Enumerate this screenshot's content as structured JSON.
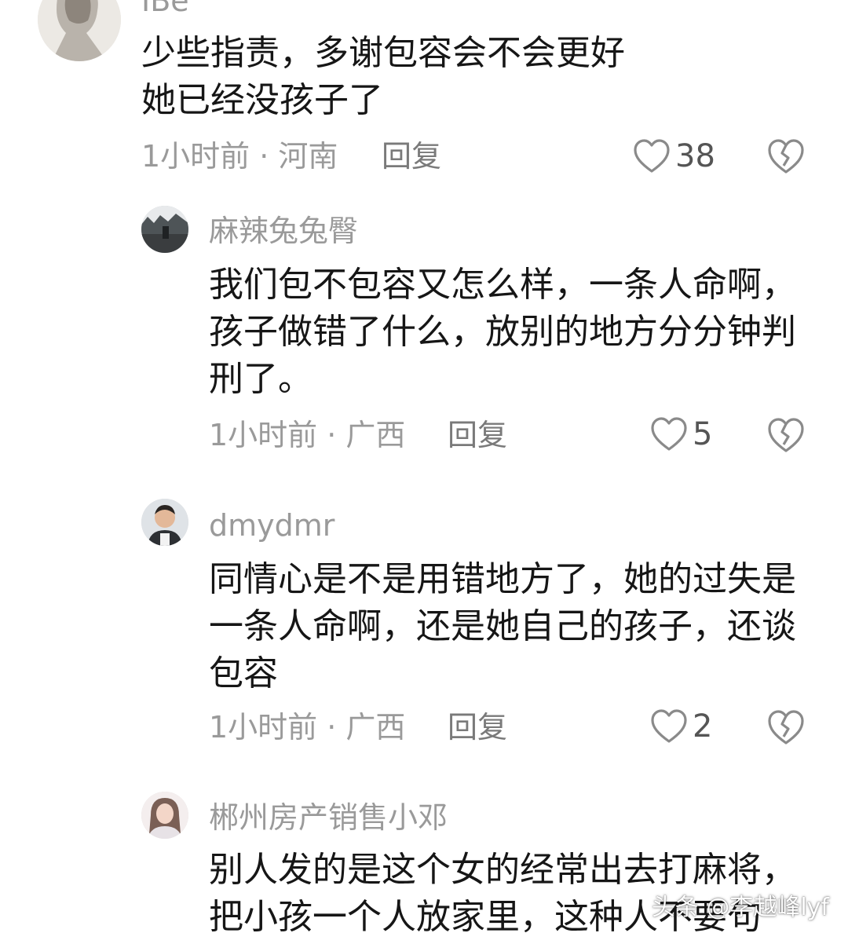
{
  "comments": [
    {
      "username": "IBe",
      "lines": [
        "少些指责，多谢包容会不会更好",
        "她已经没孩子了"
      ],
      "time_location": "1小时前 · 河南",
      "reply_label": "回复",
      "likes": "38"
    },
    {
      "username": "麻辣兔兔臀",
      "lines": [
        "我们包不包容又怎么样，一条人命啊，",
        "孩子做错了什么，放别的地方分分钟判",
        "刑了。"
      ],
      "time_location": "1小时前 · 广西",
      "reply_label": "回复",
      "likes": "5"
    },
    {
      "username": "dmydmr",
      "lines": [
        "同情心是不是用错地方了，她的过失是",
        "一条人命啊，还是她自己的孩子，还谈",
        "包容"
      ],
      "time_location": "1小时前 · 广西",
      "reply_label": "回复",
      "likes": "2"
    },
    {
      "username": "郴州房产销售小邓",
      "lines": [
        "别人发的是这个女的经常出去打麻将，",
        "把小孩一个人放家里，这种人不要句"
      ]
    }
  ],
  "watermark": "头条 @李越峰lyf",
  "colors": {
    "text": "#161616",
    "meta": "#9a9a9a",
    "icon": "#8a8a8a"
  },
  "icons": {
    "like": "heart-outline-icon",
    "dislike": "broken-heart-icon"
  }
}
